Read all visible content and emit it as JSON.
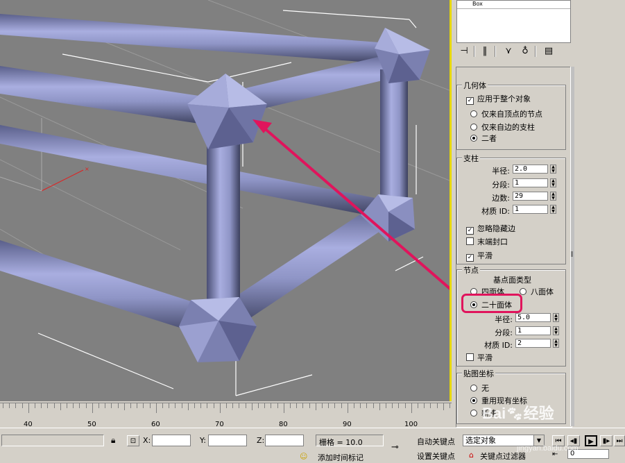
{
  "modifier_list": {
    "selected_item": "Box"
  },
  "geometry_group": {
    "title": "几何体",
    "apply_to_whole_object": {
      "label": "应用于整个对象",
      "checked": true
    },
    "options": [
      {
        "label": "仅来自顶点的节点",
        "selected": false
      },
      {
        "label": "仅来自边的支柱",
        "selected": false
      },
      {
        "label": "二者",
        "selected": true
      }
    ]
  },
  "struts_group": {
    "title": "支柱",
    "radius": {
      "label": "半径:",
      "value": "2.0"
    },
    "segments": {
      "label": "分段:",
      "value": "1"
    },
    "sides": {
      "label": "边数:",
      "value": "29"
    },
    "material_id": {
      "label": "材质 ID:",
      "value": "1"
    },
    "ignore_hidden_edges": {
      "label": "忽略隐藏边",
      "checked": true
    },
    "end_caps": {
      "label": "末端封口",
      "checked": false
    },
    "smooth": {
      "label": "平滑",
      "checked": true
    }
  },
  "nodes_group": {
    "title": "节点",
    "base_type_label": "基点面类型",
    "types": [
      {
        "label": "四面体",
        "selected": false
      },
      {
        "label": "八面体",
        "selected": false
      },
      {
        "label": "二十面体",
        "selected": true
      }
    ],
    "radius": {
      "label": "半径:",
      "value": "5.0"
    },
    "segments": {
      "label": "分段:",
      "value": "1"
    },
    "material_id": {
      "label": "材质 ID:",
      "value": "2"
    },
    "smooth": {
      "label": "平滑",
      "checked": false
    }
  },
  "mapping_group": {
    "title": "贴图坐标",
    "options": [
      {
        "label": "无",
        "selected": false
      },
      {
        "label": "重用现有坐标",
        "selected": true
      },
      {
        "label": "新建",
        "selected": false
      }
    ]
  },
  "timeline": {
    "ticks": [
      "40",
      "50",
      "60",
      "70",
      "80",
      "90",
      "100"
    ]
  },
  "statusbar": {
    "x_label": "X:",
    "y_label": "Y:",
    "z_label": "Z:",
    "grid_text": "栅格 = 10.0",
    "auto_key": "自动关键点",
    "set_key": "设置关键点",
    "selection_dropdown": "选定对象",
    "key_filters": "关键点过滤器",
    "frame_value": "0",
    "prompt_text": "添加时间标记"
  },
  "watermark": {
    "brand": "Bai",
    "suffix": "经验",
    "url": "jingyan.baidu.com"
  },
  "colors": {
    "viewport_bg": "#808080",
    "object": "#8f95c6",
    "highlight": "#e0145c",
    "active_border": "#e8d800"
  }
}
